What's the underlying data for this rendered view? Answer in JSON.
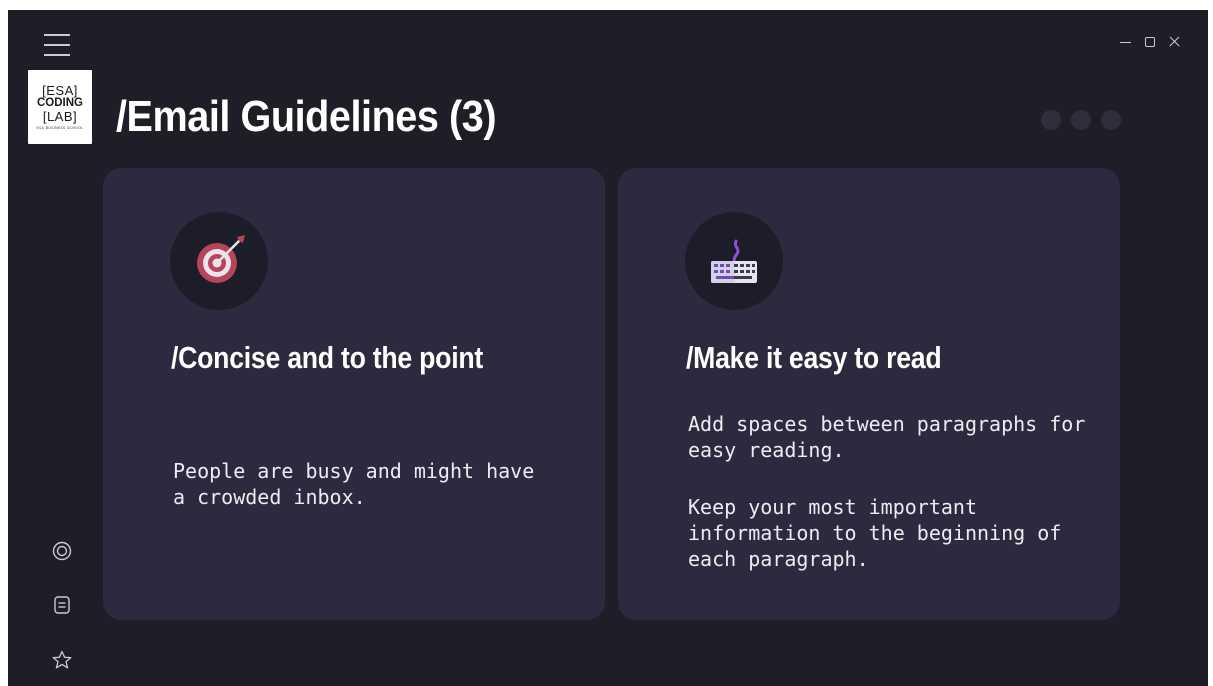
{
  "app": {
    "page_title": "/Email Guidelines (3)",
    "logo": {
      "line1": "[ESA]",
      "line2": "CODING",
      "line3": "[LAB]",
      "tagline": "ESA BUSINESS SCHOOL"
    }
  },
  "cards": [
    {
      "title": "/Concise and to the point",
      "icon": "target-icon",
      "paragraphs": [
        "People are busy and might have a crowded inbox."
      ]
    },
    {
      "title": "/Make it easy to read",
      "icon": "keyboard-icon",
      "paragraphs": [
        "Add spaces between paragraphs for easy reading.",
        "Keep your most important information to the beginning of each paragraph."
      ]
    }
  ],
  "sidebar": {
    "icons": [
      "target-icon",
      "notes-icon",
      "star-icon"
    ]
  },
  "colors": {
    "background": "#1e1e29",
    "card": "#2b2a3e",
    "icon_circle": "#1d1c29",
    "accent_blue": "#2f6fd1"
  }
}
